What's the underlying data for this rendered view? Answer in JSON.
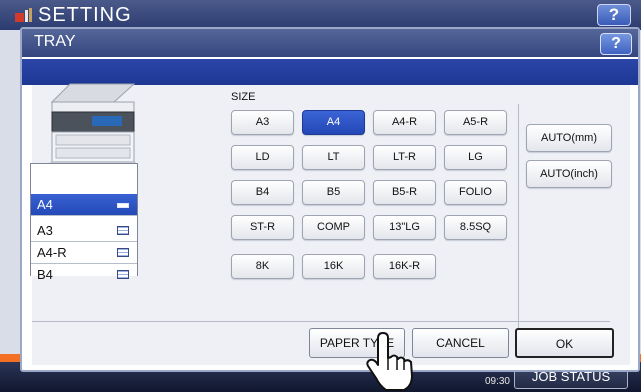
{
  "app": {
    "title": "SETTING",
    "help_label": "?"
  },
  "dialog": {
    "title": "TRAY",
    "help_label": "?"
  },
  "trays": [
    {
      "label": "A4",
      "selected": true
    },
    {
      "label": "A3",
      "selected": false
    },
    {
      "label": "A4-R",
      "selected": false
    },
    {
      "label": "B4",
      "selected": false
    }
  ],
  "size": {
    "label": "SIZE",
    "rows": [
      [
        "A3",
        "A4",
        "A4-R",
        "A5-R"
      ],
      [
        "LD",
        "LT",
        "LT-R",
        "LG"
      ],
      [
        "B4",
        "B5",
        "B5-R",
        "FOLIO"
      ],
      [
        "ST-R",
        "COMP",
        "13\"LG",
        "8.5SQ"
      ],
      [
        "8K",
        "16K",
        "16K-R"
      ]
    ],
    "selected": "A4",
    "auto": [
      "AUTO(mm)",
      "AUTO(inch)"
    ]
  },
  "footer": {
    "paper_type": "PAPER TYPE",
    "cancel": "CANCEL",
    "ok": "OK"
  },
  "status": {
    "time": "09:30",
    "job_status": "JOB STATUS"
  },
  "colors": {
    "accent": "#2449b9",
    "title_bar": "#34467e",
    "band": "#1d3793"
  }
}
